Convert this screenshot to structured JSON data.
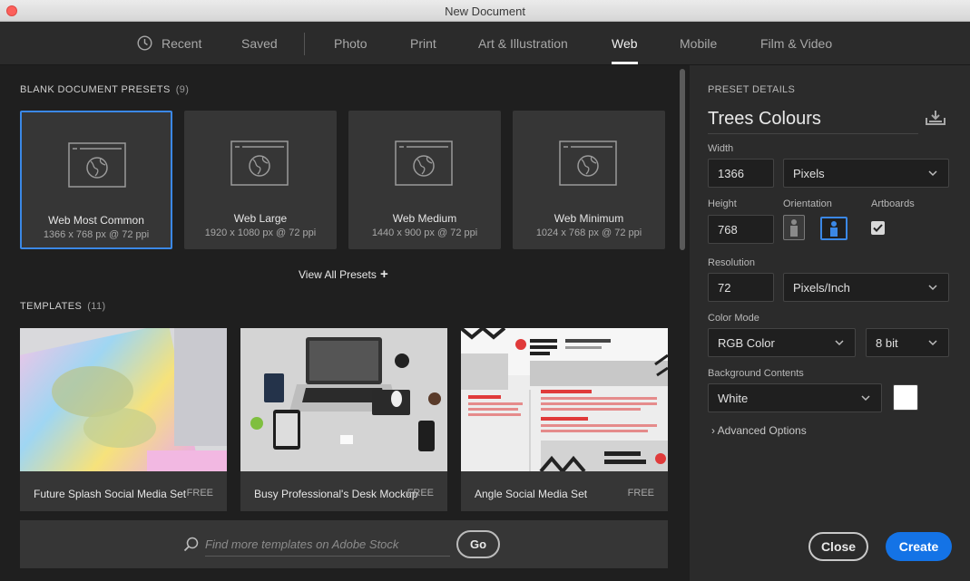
{
  "window": {
    "title": "New Document"
  },
  "tabs": [
    {
      "label": "Recent"
    },
    {
      "label": "Saved"
    },
    {
      "label": "Photo"
    },
    {
      "label": "Print"
    },
    {
      "label": "Art & Illustration"
    },
    {
      "label": "Web"
    },
    {
      "label": "Mobile"
    },
    {
      "label": "Film & Video"
    }
  ],
  "active_tab": "Web",
  "presets_section": {
    "label": "BLANK DOCUMENT PRESETS",
    "count": "(9)"
  },
  "presets": [
    {
      "name": "Web Most Common",
      "dims": "1366 x 768 px @ 72 ppi"
    },
    {
      "name": "Web Large",
      "dims": "1920 x 1080 px @ 72 ppi"
    },
    {
      "name": "Web Medium",
      "dims": "1440 x 900 px @ 72 ppi"
    },
    {
      "name": "Web Minimum",
      "dims": "1024 x 768 px @ 72 ppi"
    }
  ],
  "view_all_label": "View All Presets",
  "templates_section": {
    "label": "TEMPLATES",
    "count": "(11)"
  },
  "templates": [
    {
      "name": "Future Splash Social Media Set",
      "price": "FREE"
    },
    {
      "name": "Busy Professional's Desk Mockup",
      "price": "FREE"
    },
    {
      "name": "Angle Social Media Set",
      "price": "FREE"
    }
  ],
  "search": {
    "placeholder": "Find more templates on Adobe Stock",
    "go_label": "Go"
  },
  "details": {
    "section_label": "PRESET DETAILS",
    "name": "Trees Colours",
    "width_label": "Width",
    "width": "1366",
    "width_unit": "Pixels",
    "height_label": "Height",
    "height": "768",
    "orientation_label": "Orientation",
    "artboards_label": "Artboards",
    "artboards_checked": true,
    "resolution_label": "Resolution",
    "resolution": "72",
    "resolution_unit": "Pixels/Inch",
    "color_mode_label": "Color Mode",
    "color_mode": "RGB Color",
    "bit_depth": "8 bit",
    "background_label": "Background Contents",
    "background": "White",
    "background_color": "#ffffff",
    "advanced_label": "Advanced Options",
    "close_label": "Close",
    "create_label": "Create"
  },
  "colors": {
    "accent": "#1473e6",
    "selection": "#3b88e6"
  }
}
